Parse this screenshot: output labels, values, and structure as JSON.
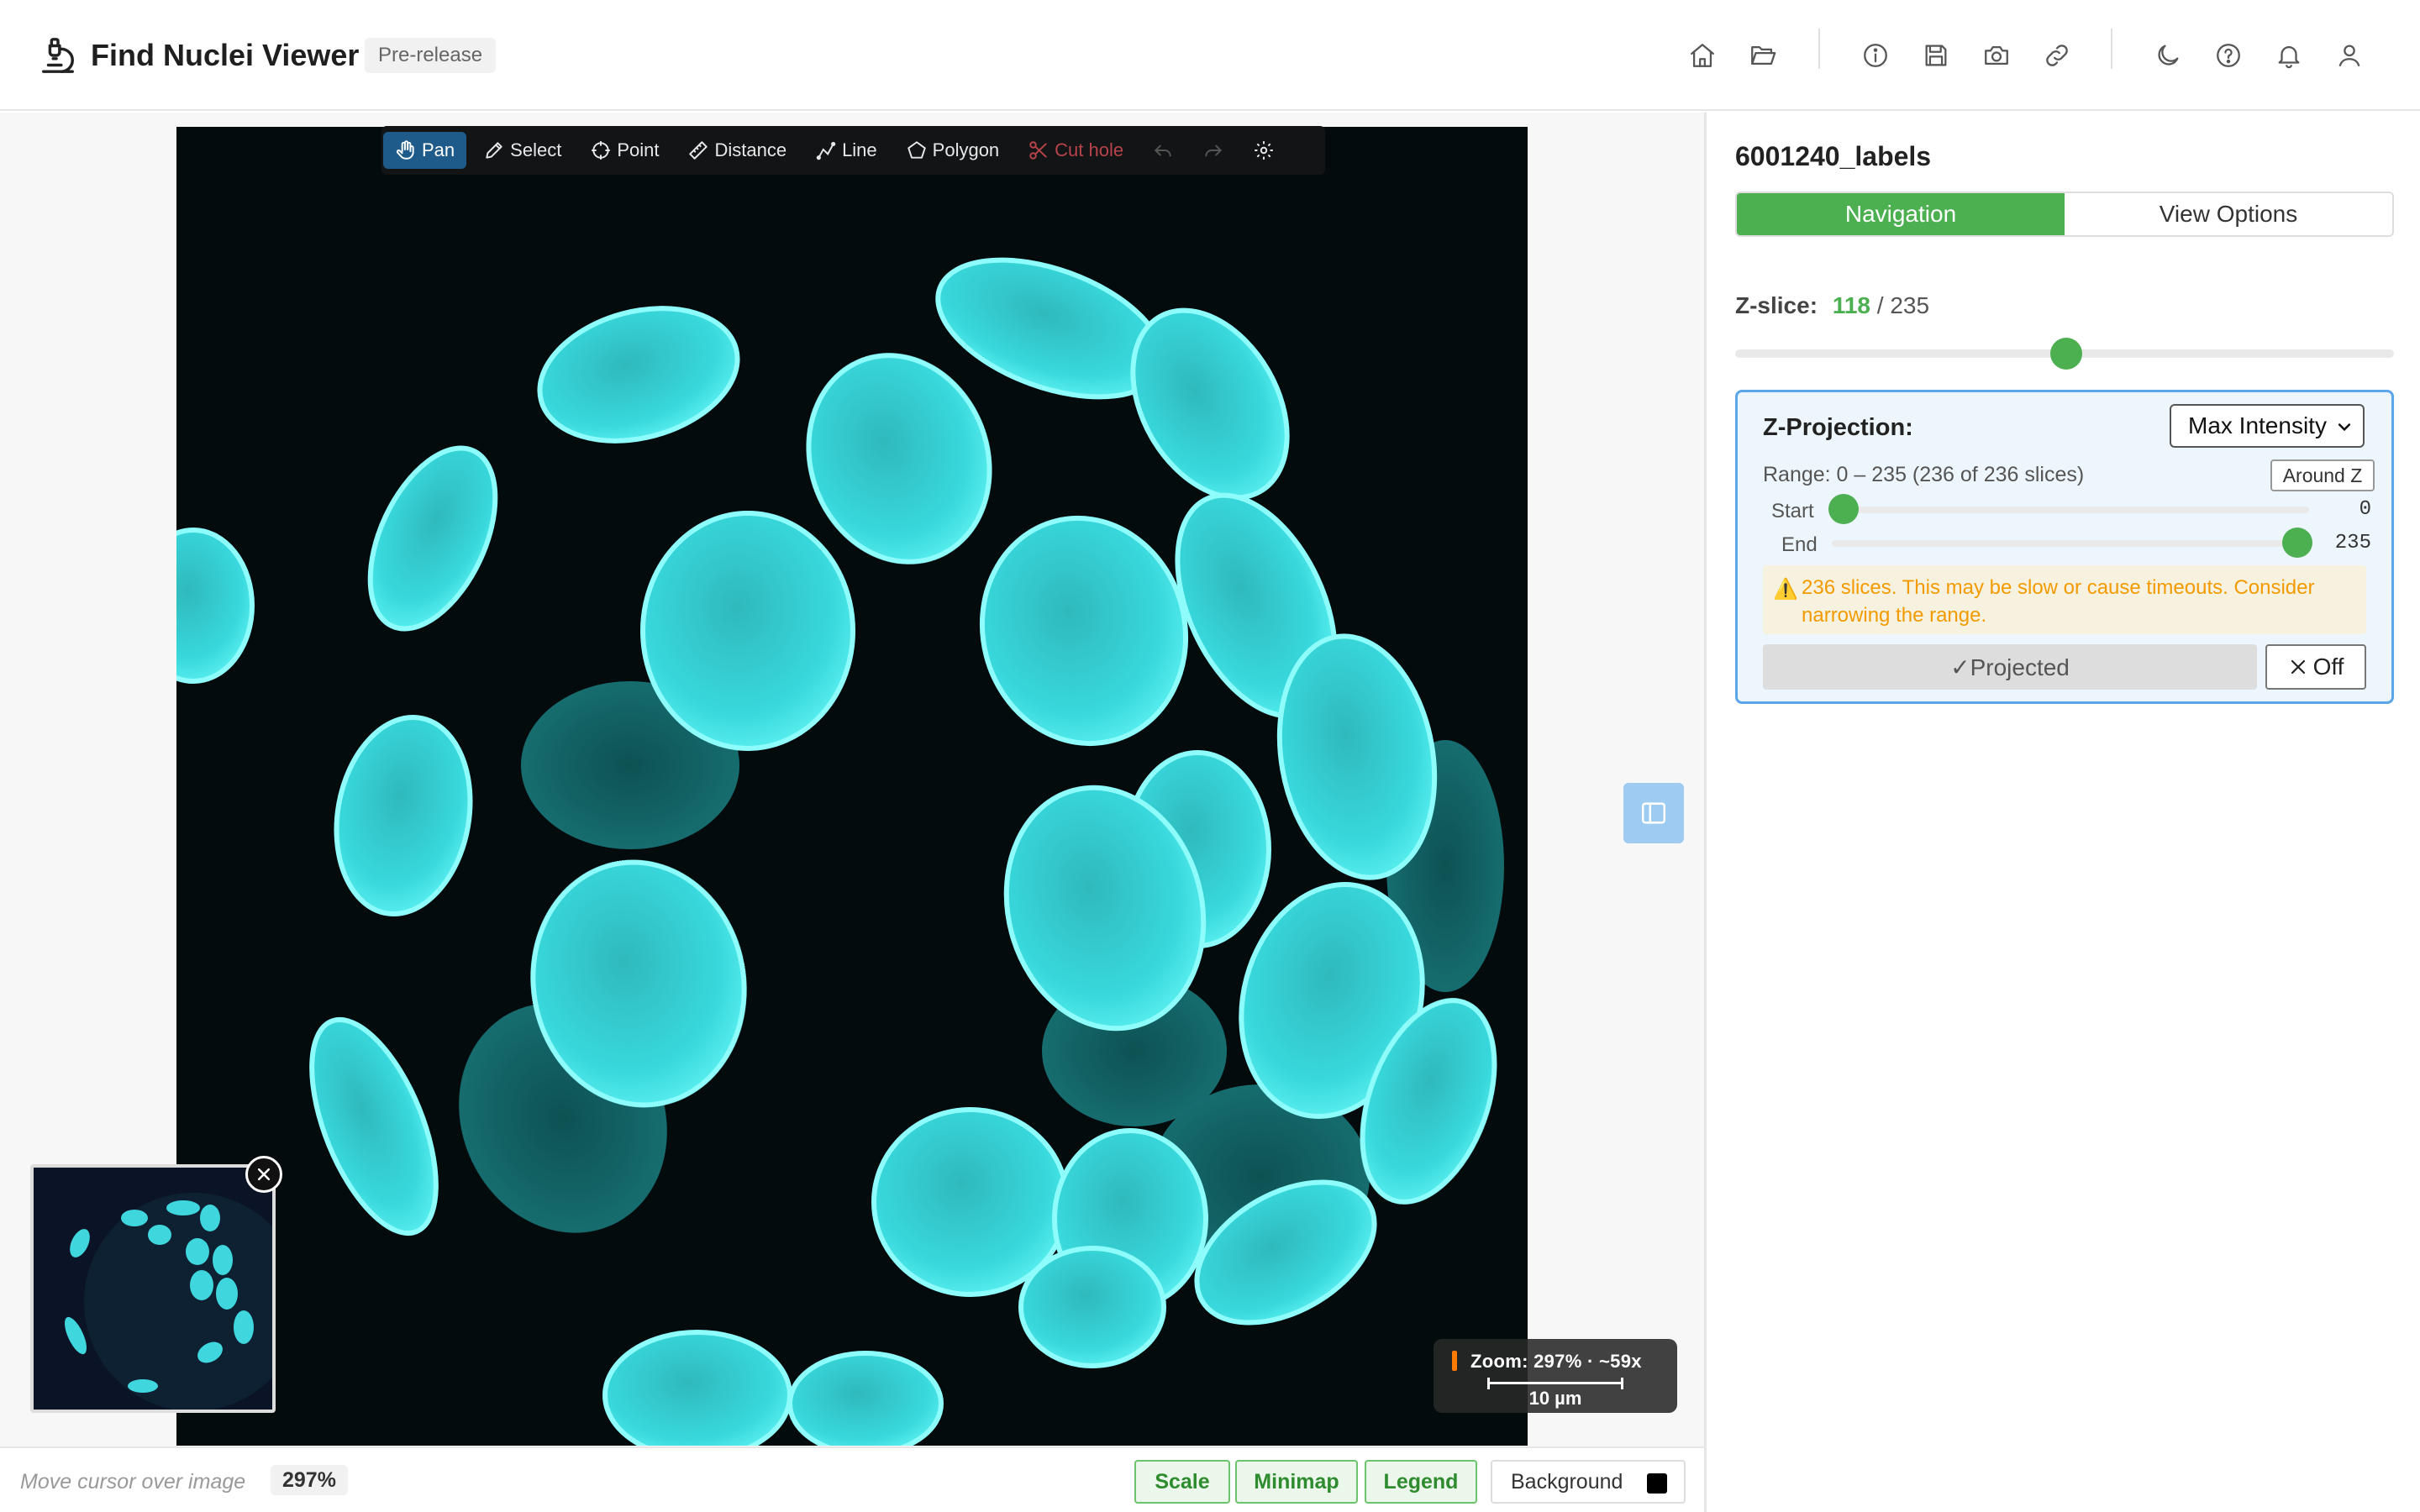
{
  "app": {
    "title": "Find Nuclei Viewer",
    "badge": "Pre-release"
  },
  "header": {
    "icons": [
      "home-icon",
      "folder-open-icon",
      "info-icon",
      "save-icon",
      "camera-icon",
      "link-icon",
      "moon-icon",
      "help-icon",
      "bell-icon",
      "user-icon"
    ]
  },
  "toolbar": {
    "tools": [
      "Pan",
      "Select",
      "Point",
      "Distance",
      "Line",
      "Polygon",
      "Cut hole"
    ],
    "active_tool": "Pan",
    "icons": [
      "undo-icon",
      "redo-icon",
      "settings-icon"
    ]
  },
  "viewer": {
    "zoom_overlay": "Zoom: 297% · ~59x",
    "scale_label": "10 µm",
    "image_color": "#3fe6e6",
    "background_color": "#000000"
  },
  "statusbar": {
    "cursor_text": "Move cursor over image",
    "zoom": "297%",
    "scale_button": "Scale",
    "minimap_button": "Minimap",
    "legend_button": "Legend",
    "background_button": "Background"
  },
  "panel": {
    "title": "6001240_labels",
    "tabs": [
      "Navigation",
      "View Options"
    ],
    "active_tab": "Navigation",
    "zslice_label": "Z-slice:",
    "zslice_current": "118",
    "zslice_total": "/ 235",
    "zslice_fraction": 0.502,
    "projection": {
      "title": "Z-Projection:",
      "method": "Max Intensity",
      "range_text": "Range: 0 – 235 (236 of 236 slices)",
      "around_button": "Around Z",
      "start_label": "Start",
      "start_value": "0",
      "start_fraction": 0.0,
      "end_label": "End",
      "end_value": "235",
      "end_fraction": 1.0,
      "warning": "236 slices. This may be slow or cause timeouts. Consider narrowing the range.",
      "projected_button": "✓Projected",
      "off_button": "Off"
    }
  },
  "colors": {
    "accent_green": "#4caf50",
    "toolbar_active": "#1e5b8a",
    "warning_text": "#f39a00",
    "projection_border": "#5aa6e8"
  }
}
